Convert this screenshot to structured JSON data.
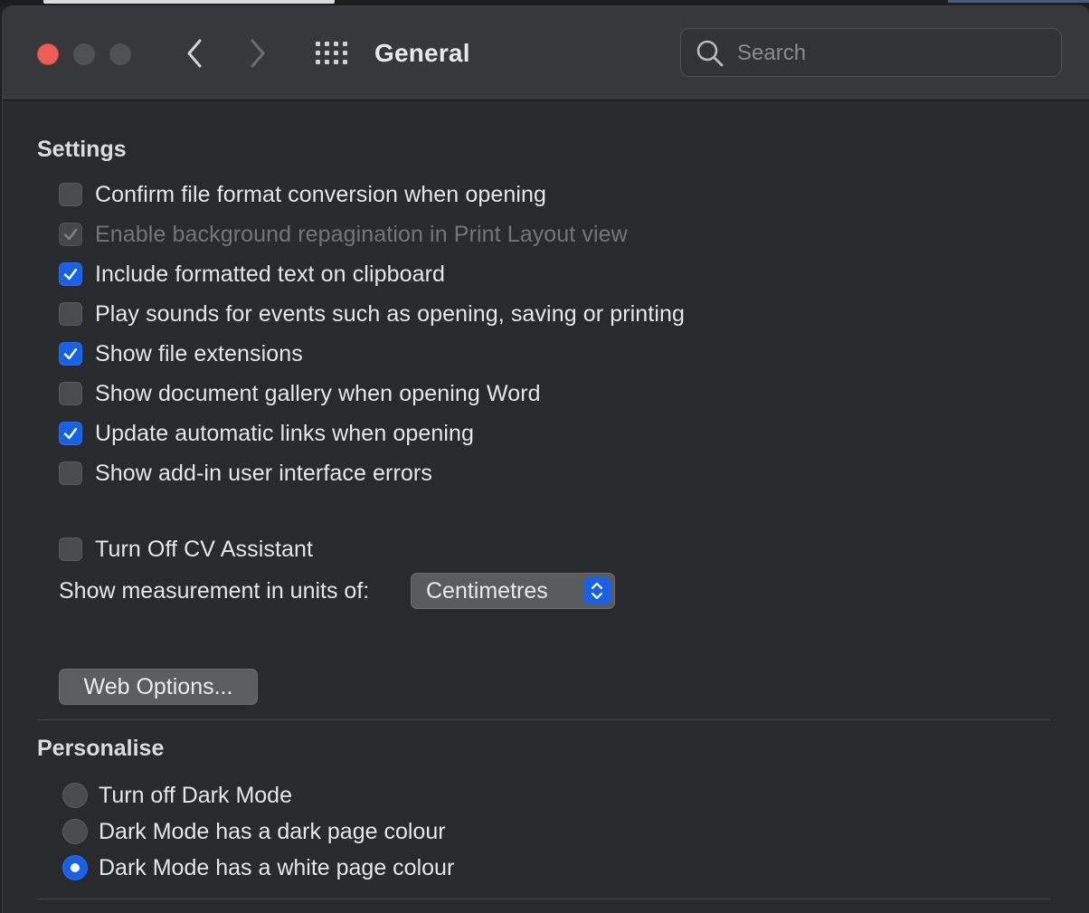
{
  "window": {
    "title": "General"
  },
  "search": {
    "placeholder": "Search"
  },
  "settings": {
    "heading": "Settings",
    "checkboxes": [
      {
        "label": "Confirm file format conversion when opening",
        "checked": false,
        "disabled": false
      },
      {
        "label": "Enable background repagination in Print Layout view",
        "checked": true,
        "disabled": true
      },
      {
        "label": "Include formatted text on clipboard",
        "checked": true,
        "disabled": false
      },
      {
        "label": "Play sounds for events such as opening, saving or printing",
        "checked": false,
        "disabled": false
      },
      {
        "label": "Show file extensions",
        "checked": true,
        "disabled": false
      },
      {
        "label": "Show document gallery when opening Word",
        "checked": false,
        "disabled": false
      },
      {
        "label": "Update automatic links when opening",
        "checked": true,
        "disabled": false
      },
      {
        "label": "Show add-in user interface errors",
        "checked": false,
        "disabled": false
      }
    ],
    "cv_assistant": {
      "label": "Turn Off CV Assistant",
      "checked": false
    },
    "units": {
      "label": "Show measurement in units of:",
      "value": "Centimetres"
    },
    "web_options_label": "Web Options..."
  },
  "personalise": {
    "heading": "Personalise",
    "radios": [
      {
        "label": "Turn off Dark Mode",
        "selected": false
      },
      {
        "label": "Dark Mode has a dark page colour",
        "selected": false
      },
      {
        "label": "Dark Mode has a white page colour",
        "selected": true
      }
    ]
  },
  "colors": {
    "accent": "#1661e5",
    "close": "#ec5e57"
  }
}
